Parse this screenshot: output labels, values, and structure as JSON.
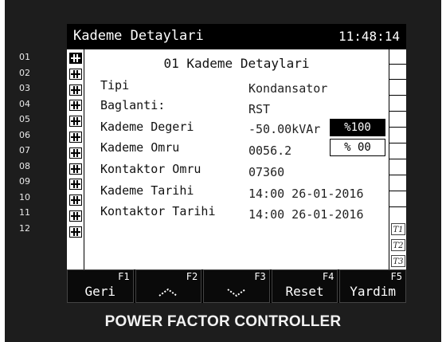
{
  "titlebar": {
    "title": "Kademe Detaylari",
    "clock": "11:48:14"
  },
  "row_numbers": [
    "01",
    "02",
    "03",
    "04",
    "05",
    "06",
    "07",
    "08",
    "09",
    "10",
    "11",
    "12"
  ],
  "active_step": 1,
  "detail": {
    "heading": "01 Kademe Detaylari",
    "fields": [
      {
        "label": "Tipi",
        "value": "Kondansator"
      },
      {
        "label": "Baglanti:",
        "value": "RST"
      },
      {
        "label": "Kademe Degeri",
        "value": "-50.00kVAr"
      },
      {
        "label": "Kademe Omru",
        "value": "0056.2"
      },
      {
        "label": "Kontaktor Omru",
        "value": "07360"
      },
      {
        "label": "Kademe Tarihi",
        "value": "14:00 26-01-2016"
      },
      {
        "label": "Kontaktor Tarihi",
        "value": "14:00 26-01-2016"
      }
    ],
    "percent_1": "%100",
    "percent_2": "% 00"
  },
  "side_tags": [
    "T1",
    "T2",
    "T3"
  ],
  "function_keys": [
    {
      "fn": "F1",
      "label": "Geri",
      "icon": ""
    },
    {
      "fn": "F2",
      "label": "",
      "icon": "arrow-up-icon"
    },
    {
      "fn": "F3",
      "label": "",
      "icon": "arrow-down-icon"
    },
    {
      "fn": "F4",
      "label": "Reset",
      "icon": ""
    },
    {
      "fn": "F5",
      "label": "Yardim",
      "icon": ""
    }
  ],
  "brand": "POWER FACTOR CONTROLLER"
}
